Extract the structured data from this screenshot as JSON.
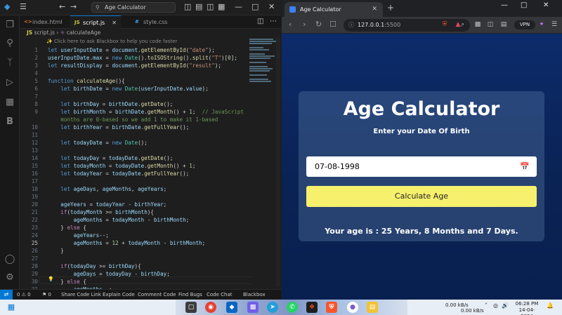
{
  "vscode": {
    "search_text": "Age Calculator",
    "tabs": [
      {
        "label": "index.html",
        "icon": "<>"
      },
      {
        "label": "script.js",
        "icon": "JS"
      },
      {
        "label": "style.css",
        "icon": "#"
      }
    ],
    "breadcrumb_file": "script.js",
    "breadcrumb_symbol": "calculateAge",
    "hint": "Click here to ask Blackbox to help you code faster",
    "current_line": "25",
    "status_items": [
      "0 ⚠ 0",
      "⚑ 0",
      "Share Code Link",
      "Explain Code",
      "Comment Code",
      "Find Bugs",
      "Code Chat",
      "Blackbox"
    ]
  },
  "code_lines": [
    {
      "n": "1",
      "html": "<span class='kw'>let</span> <span class='var'>userInputDate</span> <span class='pl'>=</span> <span class='var'>document</span><span class='pl'>.</span><span class='fn'>getElementById</span><span class='pl'>(</span><span class='str'>\"date\"</span><span class='pl'>);</span>"
    },
    {
      "n": "2",
      "html": "<span class='var'>userInputDate</span><span class='pl'>.</span><span class='var'>max</span> <span class='pl'>=</span> <span class='kw'>new</span> <span class='cls'>Date</span><span class='pl'>().</span><span class='fn'>toISOString</span><span class='pl'>().</span><span class='fn'>split</span><span class='pl'>(</span><span class='str'>\"T\"</span><span class='pl'>)[</span><span class='num'>0</span><span class='pl'>];</span>"
    },
    {
      "n": "3",
      "html": "<span class='kw'>let</span> <span class='var'>resultDisplay</span> <span class='pl'>=</span> <span class='var'>document</span><span class='pl'>.</span><span class='fn'>getElementById</span><span class='pl'>(</span><span class='str'>\"result\"</span><span class='pl'>);</span>"
    },
    {
      "n": "4",
      "html": ""
    },
    {
      "n": "5",
      "html": "<span class='kw'>function</span> <span class='fn'>calculateAge</span><span class='pl'>(){</span>"
    },
    {
      "n": "6",
      "html": "    <span class='kw'>let</span> <span class='var'>birthDate</span> <span class='pl'>=</span> <span class='kw'>new</span> <span class='cls'>Date</span><span class='pl'>(</span><span class='var'>userInputDate</span><span class='pl'>.</span><span class='var'>value</span><span class='pl'>);</span>"
    },
    {
      "n": "7",
      "html": ""
    },
    {
      "n": "8",
      "html": "    <span class='kw'>let</span> <span class='var'>birthDay</span> <span class='pl'>=</span> <span class='var'>birthDate</span><span class='pl'>.</span><span class='fn'>getDate</span><span class='pl'>();</span>"
    },
    {
      "n": "9",
      "html": "    <span class='kw'>let</span> <span class='var'>birthMonth</span> <span class='pl'>=</span> <span class='var'>birthDate</span><span class='pl'>.</span><span class='fn'>getMonth</span><span class='pl'>()</span> <span class='pl'>+</span> <span class='num'>1</span><span class='pl'>;</span>  <span class='cm'>// JavaScript</span>"
    },
    {
      "n": "",
      "html": "    <span class='cm'>months are 0-based so we add 1 to make it 1-based</span>"
    },
    {
      "n": "10",
      "html": "    <span class='kw'>let</span> <span class='var'>birthYear</span> <span class='pl'>=</span> <span class='var'>birthDate</span><span class='pl'>.</span><span class='fn'>getFullYear</span><span class='pl'>();</span>"
    },
    {
      "n": "11",
      "html": ""
    },
    {
      "n": "12",
      "html": "    <span class='kw'>let</span> <span class='var'>todayDate</span> <span class='pl'>=</span> <span class='kw'>new</span> <span class='cls'>Date</span><span class='pl'>();</span>"
    },
    {
      "n": "13",
      "html": ""
    },
    {
      "n": "14",
      "html": "    <span class='kw'>let</span> <span class='var'>todayDay</span> <span class='pl'>=</span> <span class='var'>todayDate</span><span class='pl'>.</span><span class='fn'>getDate</span><span class='pl'>();</span>"
    },
    {
      "n": "15",
      "html": "    <span class='kw'>let</span> <span class='var'>todayMonth</span> <span class='pl'>=</span> <span class='var'>todayDate</span><span class='pl'>.</span><span class='fn'>getMonth</span><span class='pl'>()</span> <span class='pl'>+</span> <span class='num'>1</span><span class='pl'>;</span>"
    },
    {
      "n": "16",
      "html": "    <span class='kw'>let</span> <span class='var'>todayYear</span> <span class='pl'>=</span> <span class='var'>todayDate</span><span class='pl'>.</span><span class='fn'>getFullYear</span><span class='pl'>();</span>"
    },
    {
      "n": "17",
      "html": ""
    },
    {
      "n": "18",
      "html": "    <span class='kw'>let</span> <span class='var'>ageDays</span><span class='pl'>,</span> <span class='var'>ageMonths</span><span class='pl'>,</span> <span class='var'>ageYears</span><span class='pl'>;</span>"
    },
    {
      "n": "19",
      "html": ""
    },
    {
      "n": "20",
      "html": "    <span class='var'>ageYears</span> <span class='pl'>=</span> <span class='var'>todayYear</span> <span class='pl'>-</span> <span class='var'>birthYear</span><span class='pl'>;</span>"
    },
    {
      "n": "21",
      "html": "    <span class='kw2'>if</span><span class='pl'>(</span><span class='var'>todayMonth</span> <span class='pl'>&gt;=</span> <span class='var'>birthMonth</span><span class='pl'>){</span>"
    },
    {
      "n": "22",
      "html": "        <span class='var'>ageMonths</span> <span class='pl'>=</span> <span class='var'>todayMonth</span> <span class='pl'>-</span> <span class='var'>birthMonth</span><span class='pl'>;</span>"
    },
    {
      "n": "23",
      "html": "    <span class='pl'>}</span> <span class='kw2'>else</span> <span class='pl'>{</span>"
    },
    {
      "n": "24",
      "html": "        <span class='var'>ageYears</span><span class='pl'>--;</span>"
    },
    {
      "n": "25",
      "html": "        <span class='var'>ageMonths</span> <span class='pl'>=</span> <span class='num'>12</span> <span class='pl'>+</span> <span class='var'>todayMonth</span> <span class='pl'>-</span> <span class='var'>birthMonth</span><span class='pl'>;</span>"
    },
    {
      "n": "26",
      "html": "    <span class='pl'>}</span>"
    },
    {
      "n": "27",
      "html": ""
    },
    {
      "n": "28",
      "html": "    <span class='kw2'>if</span><span class='pl'>(</span><span class='var'>todayDay</span> <span class='pl'>&gt;=</span> <span class='var'>birthDay</span><span class='pl'>){</span>"
    },
    {
      "n": "29",
      "html": "        <span class='var'>ageDays</span> <span class='pl'>=</span> <span class='var'>todayDay</span> <span class='pl'>-</span> <span class='var'>birthDay</span><span class='pl'>;</span>"
    },
    {
      "n": "30",
      "html": "    <span class='pl'>}</span> <span class='kw2'>else</span> <span class='pl'>{</span>"
    },
    {
      "n": "31",
      "html": "        <span class='var'>ageMonths</span><span class='pl'>--;</span>"
    }
  ],
  "browser": {
    "tab_title": "Age Calculator",
    "url_host": "127.0.0.1",
    "url_port": ":5500",
    "vpn_label": "VPN"
  },
  "app": {
    "title": "Age Calculator",
    "subtitle": "Enter your Date Of Birth",
    "date_value": "07-08-1998",
    "button_label": "Calculate Age",
    "result_text": "Your age is : 25 Years, 8 Months and 7 Days."
  },
  "taskbar": {
    "net_up": "0.00 kB/s",
    "net_down": "0.00 kB/s",
    "time": "06:28 PM",
    "date": "14-04-2024"
  }
}
